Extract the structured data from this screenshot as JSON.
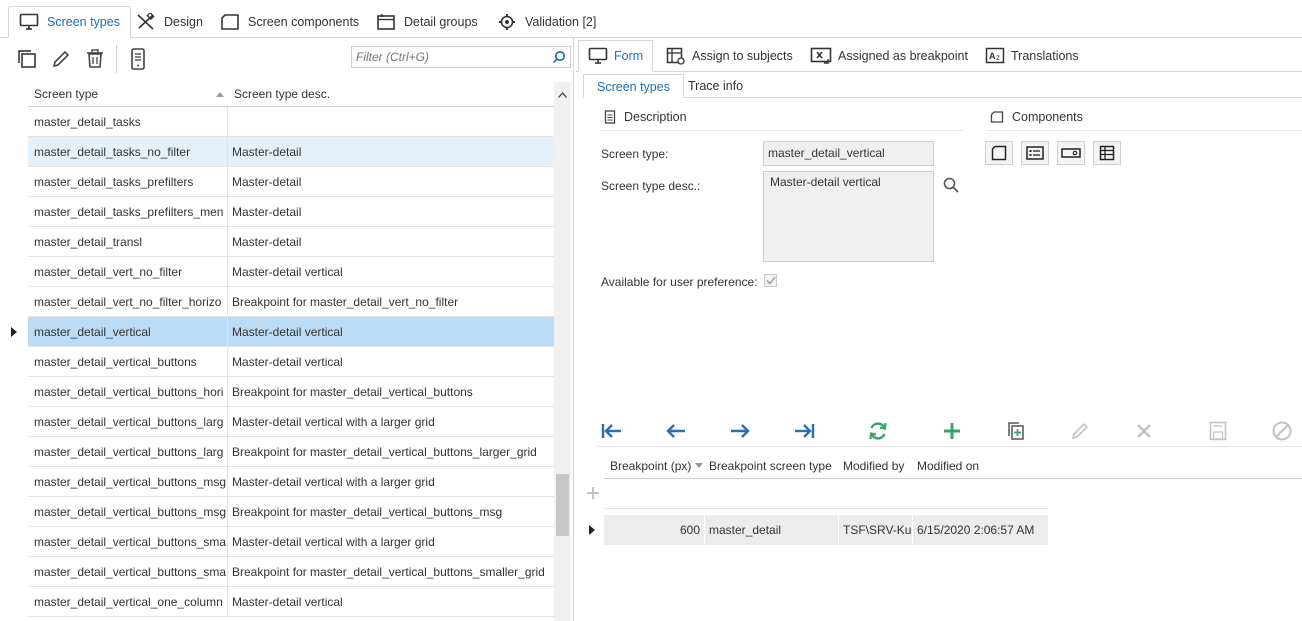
{
  "top_tabs": [
    {
      "label": "Screen types",
      "icon": "monitor-icon"
    },
    {
      "label": "Design",
      "icon": "design-tools-icon"
    },
    {
      "label": "Screen components",
      "icon": "component-icon"
    },
    {
      "label": "Detail groups",
      "icon": "detail-groups-icon"
    },
    {
      "label": "Validation [2]",
      "icon": "validation-gear-icon"
    }
  ],
  "left_toolbar": {
    "buttons": [
      "copy-icon",
      "edit-pencil-icon",
      "delete-trash-icon",
      "mobile-device-icon"
    ],
    "filter_placeholder": "Filter (Ctrl+G)"
  },
  "grid": {
    "columns": [
      "Screen type",
      "Screen type desc."
    ],
    "rows": [
      {
        "type": "master_detail_tasks",
        "desc": ""
      },
      {
        "type": "master_detail_tasks_no_filter",
        "desc": "Master-detail"
      },
      {
        "type": "master_detail_tasks_prefilters",
        "desc": "Master-detail"
      },
      {
        "type": "master_detail_tasks_prefilters_men",
        "desc": "Master-detail"
      },
      {
        "type": "master_detail_transl",
        "desc": "Master-detail"
      },
      {
        "type": "master_detail_vert_no_filter",
        "desc": "Master-detail vertical"
      },
      {
        "type": "master_detail_vert_no_filter_horizo",
        "desc": "Breakpoint for master_detail_vert_no_filter"
      },
      {
        "type": "master_detail_vertical",
        "desc": "Master-detail vertical"
      },
      {
        "type": "master_detail_vertical_buttons",
        "desc": "Master-detail vertical"
      },
      {
        "type": "master_detail_vertical_buttons_hori",
        "desc": "Breakpoint for master_detail_vertical_buttons"
      },
      {
        "type": "master_detail_vertical_buttons_larg",
        "desc": "Master-detail vertical with a larger grid"
      },
      {
        "type": "master_detail_vertical_buttons_larg",
        "desc": "Breakpoint for master_detail_vertical_buttons_larger_grid"
      },
      {
        "type": "master_detail_vertical_buttons_msg",
        "desc": "Master-detail vertical with a larger grid"
      },
      {
        "type": "master_detail_vertical_buttons_msg",
        "desc": "Breakpoint for master_detail_vertical_buttons_msg"
      },
      {
        "type": "master_detail_vertical_buttons_sma",
        "desc": "Master-detail vertical with a larger grid"
      },
      {
        "type": "master_detail_vertical_buttons_sma",
        "desc": "Breakpoint for master_detail_vertical_buttons_smaller_grid"
      },
      {
        "type": "master_detail_vertical_one_column",
        "desc": "Master-detail vertical"
      }
    ]
  },
  "right_tabs": [
    {
      "label": "Form",
      "icon": "monitor-icon"
    },
    {
      "label": "Assign to subjects",
      "icon": "assign-grid-icon"
    },
    {
      "label": "Assigned as breakpoint",
      "icon": "breakpoint-icon"
    },
    {
      "label": "Translations",
      "icon": "translate-icon"
    }
  ],
  "sub_tabs": [
    "Screen types",
    "Trace info"
  ],
  "form": {
    "description_title": "Description",
    "components_title": "Components",
    "screen_type_label": "Screen type:",
    "screen_type_value": "master_detail_vertical",
    "desc_label": "Screen type desc.:",
    "desc_value": "Master-detail vertical",
    "available_label": "Available for user preference:",
    "available_checked": true
  },
  "nav_buttons": [
    "first-icon",
    "previous-icon",
    "next-icon",
    "last-icon",
    "refresh-icon",
    "add-icon",
    "copy-record-icon",
    "edit-icon",
    "delete-icon",
    "save-icon",
    "cancel-icon"
  ],
  "breakpoints": {
    "columns": [
      "Breakpoint (px)",
      "Breakpoint screen type",
      "Modified by",
      "Modified on"
    ],
    "rows": [
      {
        "px": "600",
        "screen_type": "master_detail",
        "modified_by": "TSF\\SRV-Ku",
        "modified_on": "6/15/2020 2:06:57 AM"
      }
    ]
  },
  "colors": {
    "accent": "#1e6fb5",
    "selected_row": "#bcdcf6",
    "hover_row": "#e4f0fa",
    "add_green": "#3aa36a"
  }
}
